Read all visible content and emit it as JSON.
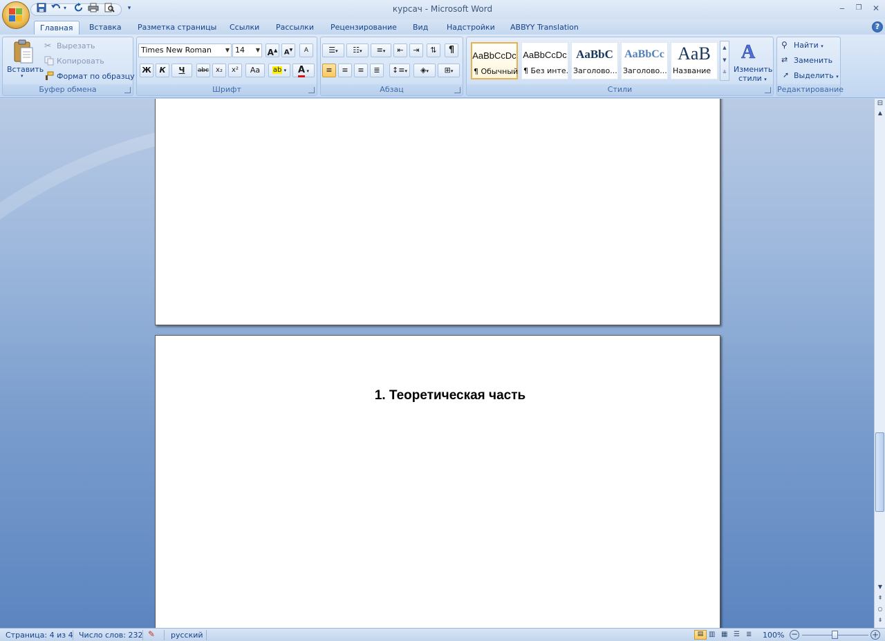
{
  "window": {
    "title": "курсач - Microsoft Word",
    "minimize": "‒",
    "restore": "❐",
    "close": "✕"
  },
  "qat": {
    "save_icon": "save-icon",
    "undo_icon": "undo-icon",
    "redo_icon": "redo-icon",
    "print_icon": "print-icon",
    "preview_icon": "print-preview-icon",
    "customize": "▾"
  },
  "tabs": [
    {
      "label": "Главная"
    },
    {
      "label": "Вставка"
    },
    {
      "label": "Разметка страницы"
    },
    {
      "label": "Ссылки"
    },
    {
      "label": "Рассылки"
    },
    {
      "label": "Рецензирование"
    },
    {
      "label": "Вид"
    },
    {
      "label": "Надстройки"
    },
    {
      "label": "ABBYY Translation"
    }
  ],
  "clipboard": {
    "group": "Буфер обмена",
    "paste": "Вставить",
    "cut": "Вырезать",
    "copy": "Копировать",
    "format_painter": "Формат по образцу"
  },
  "font": {
    "group": "Шрифт",
    "name": "Times New Roman",
    "size": "14",
    "bold": "Ж",
    "italic": "К",
    "underline": "Ч",
    "strike": "abc",
    "subscript": "x₂",
    "superscript": "x²",
    "case": "Aa",
    "highlight": "ab",
    "color": "A",
    "grow": "A",
    "shrink": "A",
    "clear": "A"
  },
  "paragraph": {
    "group": "Абзац",
    "show_marks": "¶"
  },
  "styles": {
    "group": "Стили",
    "items": [
      {
        "sample": "AaBbCcDc",
        "name": "¶ Обычный"
      },
      {
        "sample": "AaBbCcDc",
        "name": "¶ Без инте..."
      },
      {
        "sample": "AaBbC",
        "name": "Заголово..."
      },
      {
        "sample": "AaBbCc",
        "name": "Заголово..."
      },
      {
        "sample": "AaB",
        "name": "Название"
      }
    ],
    "change": "Изменить",
    "change2": "стили"
  },
  "editing": {
    "group": "Редактирование",
    "find": "Найти",
    "replace": "Заменить",
    "select": "Выделить"
  },
  "document": {
    "heading": "1. Теоретическая часть"
  },
  "status": {
    "page": "Страница: 4 из 4",
    "words": "Число слов: 232",
    "language": "русский",
    "zoom": "100%"
  }
}
